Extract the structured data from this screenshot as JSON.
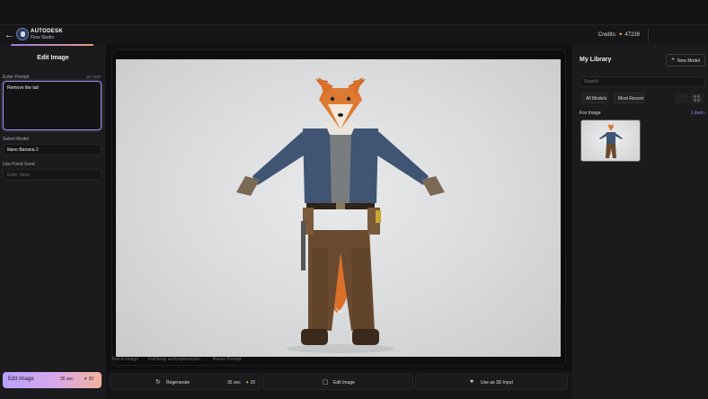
{
  "header": {
    "back_icon": "arrow-left-icon",
    "brand_name": "AUTODESK",
    "brand_sub": "Flow Studio",
    "credits_label": "Credits:",
    "credits_value": "47228"
  },
  "left_panel": {
    "title": "Edit Image",
    "prompt_label": "Enter Prompt",
    "prompt_count": "18 / 500",
    "prompt_value": "Remove the tail",
    "model_label": "Select Model",
    "model_value": "Nano Banana 2",
    "seed_label": "Use Fixed Seed",
    "seed_placeholder": "Enter Seed",
    "edit_button": {
      "label": "Edit Image",
      "time": "35 sec",
      "cost": "20"
    }
  },
  "canvas": {
    "tags": [
      "Text to Image",
      "Full-body anthropomorphi...",
      "Reuse Prompt"
    ]
  },
  "actions": {
    "regenerate_label": "Regenerate",
    "regenerate_time": "35 sec",
    "regenerate_cost": "20",
    "edit_label": "Edit Image",
    "use3d_label": "Use as 3D Input"
  },
  "library": {
    "title": "My Library",
    "new_model_label": "New Model",
    "search_placeholder": "Search",
    "filters": [
      "All Models",
      "Most Recent"
    ],
    "folder_name": "Fox Image",
    "item_count": "1 item"
  },
  "colors": {
    "accent_purple": "#a28be0",
    "credit_star": "#f2c94c"
  }
}
